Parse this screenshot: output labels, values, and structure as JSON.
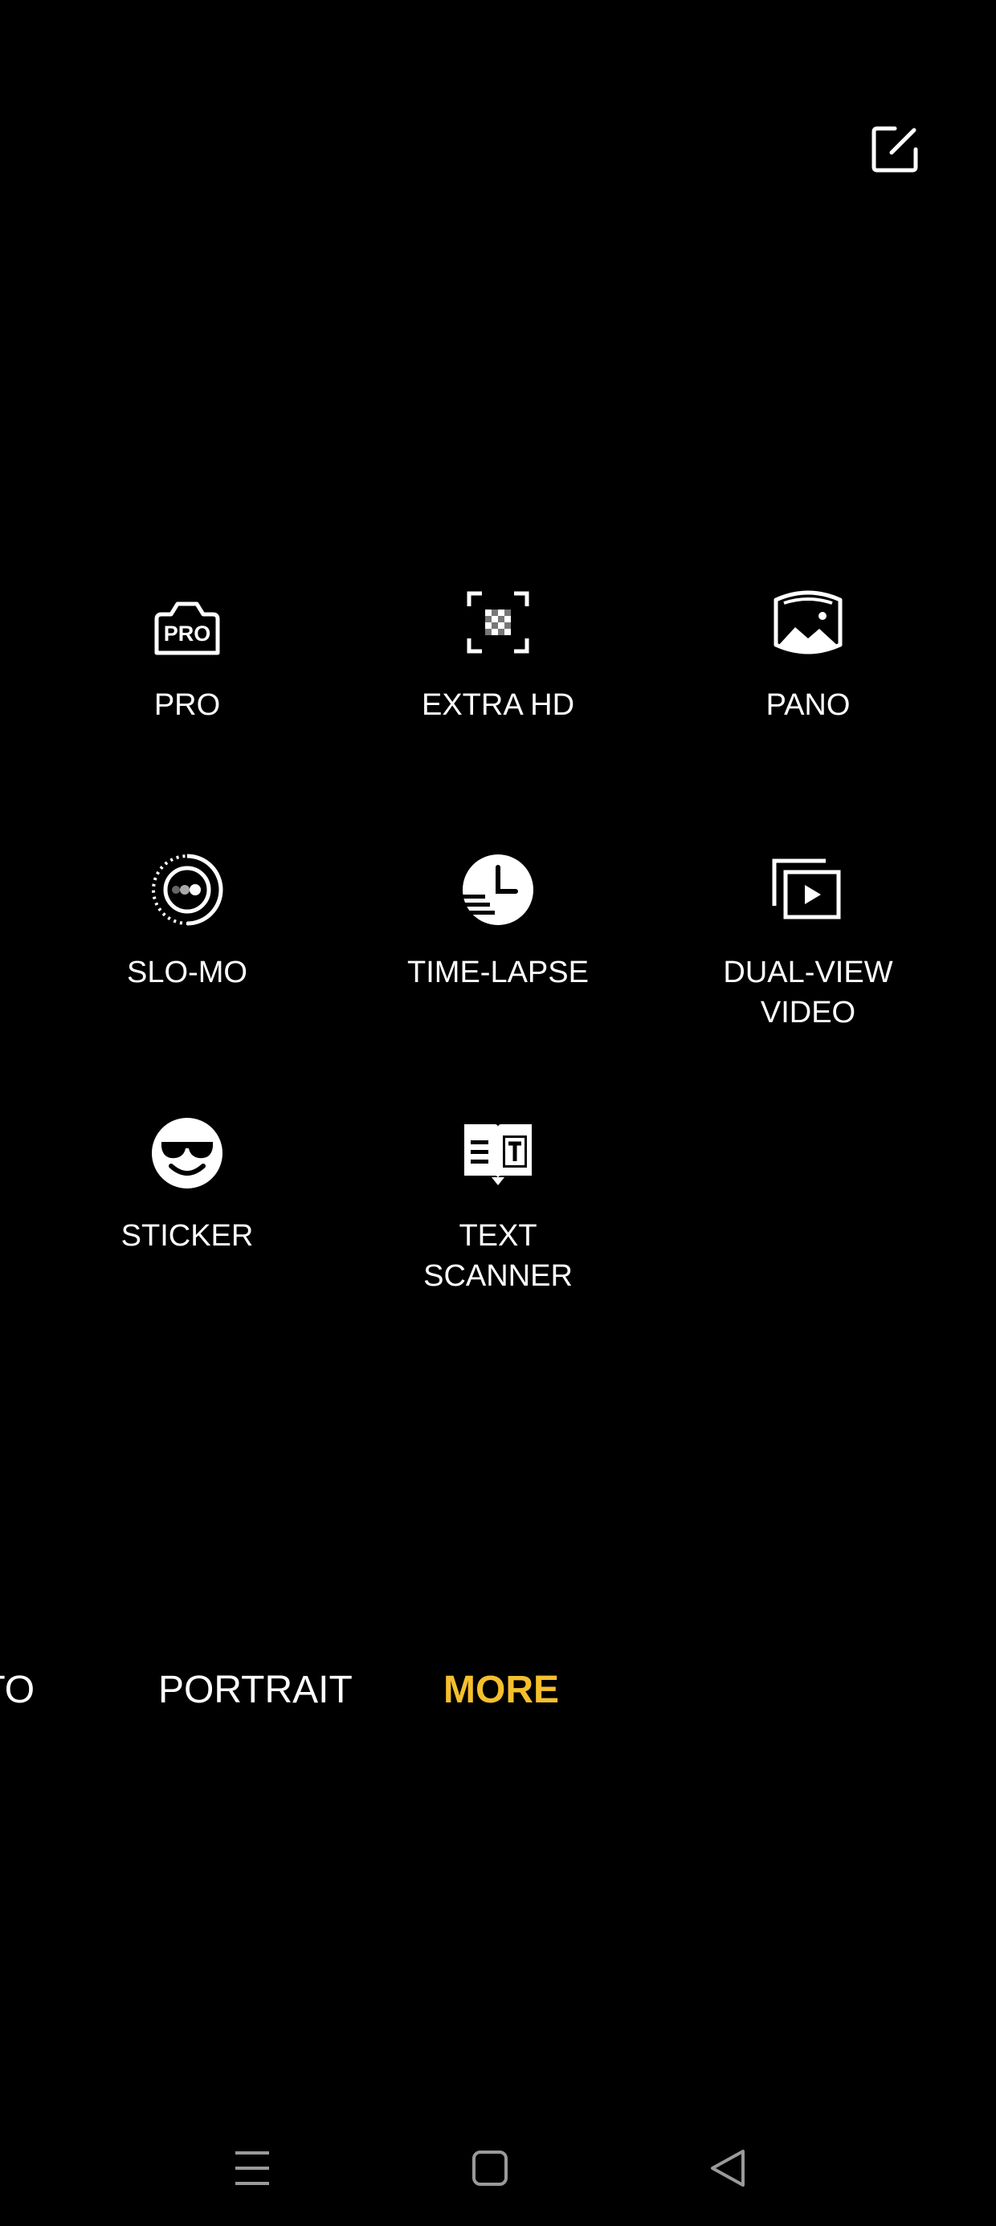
{
  "header": {
    "edit_icon": "edit-square-icon"
  },
  "modes": [
    {
      "id": "pro",
      "label": "PRO",
      "icon": "pro-camera-icon"
    },
    {
      "id": "extra-hd",
      "label": "EXTRA HD",
      "icon": "extra-hd-grid-icon"
    },
    {
      "id": "pano",
      "label": "PANO",
      "icon": "panorama-icon"
    },
    {
      "id": "slo-mo",
      "label": "SLO-MO",
      "icon": "slow-motion-icon"
    },
    {
      "id": "time-lapse",
      "label": "TIME-LAPSE",
      "icon": "time-lapse-clock-icon"
    },
    {
      "id": "dual-view-video",
      "label_line1": "DUAL-VIEW",
      "label_line2": "VIDEO",
      "icon": "dual-view-video-icon"
    },
    {
      "id": "sticker",
      "label": "STICKER",
      "icon": "sunglasses-smiley-icon"
    },
    {
      "id": "text-scanner",
      "label_line1": "TEXT",
      "label_line2": "SCANNER",
      "icon": "text-scanner-book-icon"
    }
  ],
  "tabs": {
    "photo": "OTO",
    "portrait": "PORTRAIT",
    "more": "MORE"
  },
  "colors": {
    "background": "#000000",
    "text": "#ffffff",
    "active_tab": "#F5BF2E",
    "nav_icon": "#9a9a9a"
  },
  "navbar": {
    "menu_icon": "menu-lines-icon",
    "home_icon": "home-square-icon",
    "back_icon": "back-triangle-icon"
  }
}
